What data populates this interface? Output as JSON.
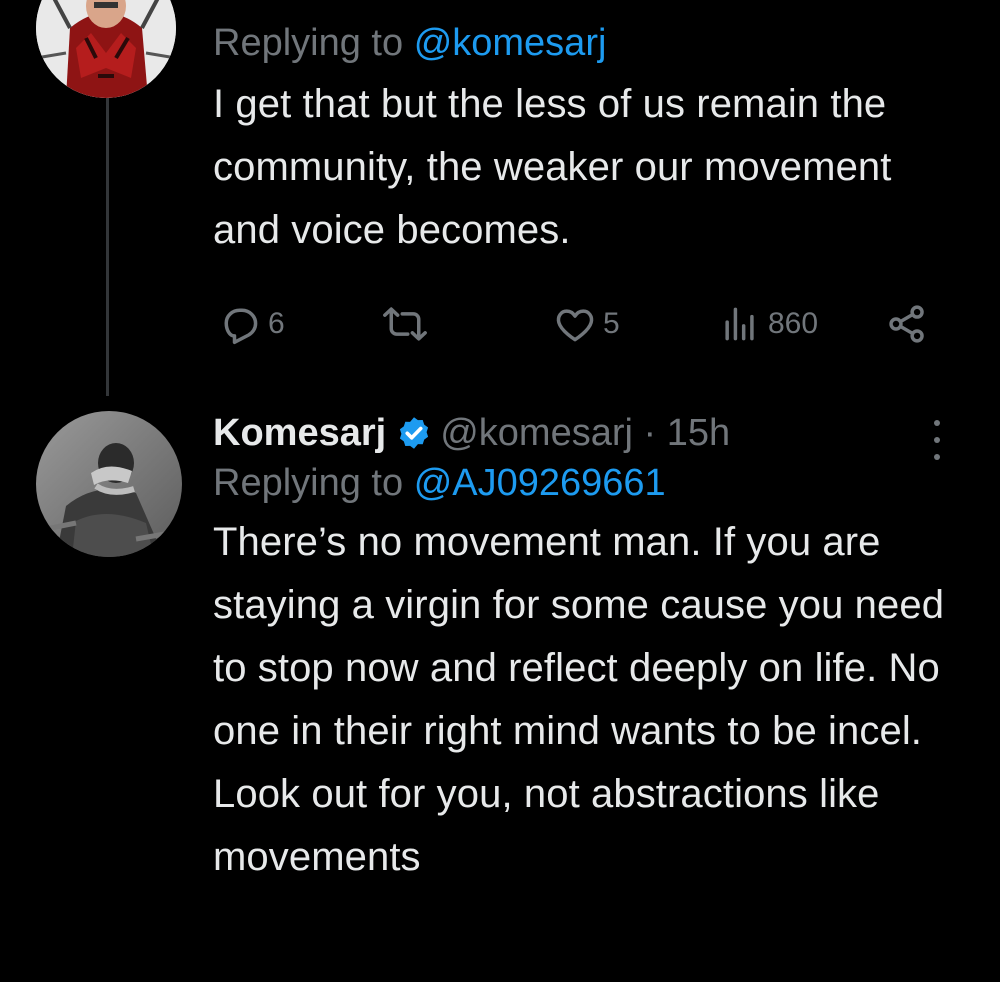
{
  "tweet1": {
    "replying_prefix": "Replying to",
    "replying_mention": "@komesarj",
    "body": "I get that but the less of us remain the community, the weaker our movement and voice becomes.",
    "actions": {
      "reply_icon": "reply-icon",
      "reply_count": "6",
      "retweet_icon": "retweet-icon",
      "retweet_count": "",
      "like_icon": "heart-icon",
      "like_count": "5",
      "views_icon": "views-icon",
      "views_count": "860",
      "share_icon": "share-icon"
    }
  },
  "tweet2": {
    "display_name": "Komesarj",
    "verified_icon": "verified-badge-icon",
    "handle_time": "@komesarj · 15h",
    "replying_prefix": "Replying to",
    "replying_mention": "@AJ09269661",
    "body": "There’s no movement man. If you are staying a virgin for some cause you need to stop now and reflect deeply on life. No one in their right mind wants to be incel. Look out for you, not abstractions like movements"
  },
  "colors": {
    "background": "#000000",
    "text": "#e7e9ea",
    "secondary": "#71767b",
    "link": "#1d9bf0",
    "thread_line": "#333639"
  }
}
